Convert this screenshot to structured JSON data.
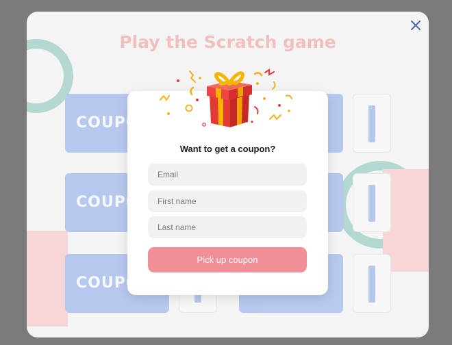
{
  "background_game": {
    "title": "Play the Scratch game",
    "coupon_label": "COUPON"
  },
  "close": {
    "icon": "close-icon",
    "color": "#4a6fa5"
  },
  "popup": {
    "title": "Want to get a coupon?",
    "gift_icon": "gift-box-icon",
    "fields": {
      "email_placeholder": "Email",
      "first_name_placeholder": "First name",
      "last_name_placeholder": "Last name"
    },
    "submit_label": "Pick up coupon",
    "submit_color": "#f08f97"
  }
}
